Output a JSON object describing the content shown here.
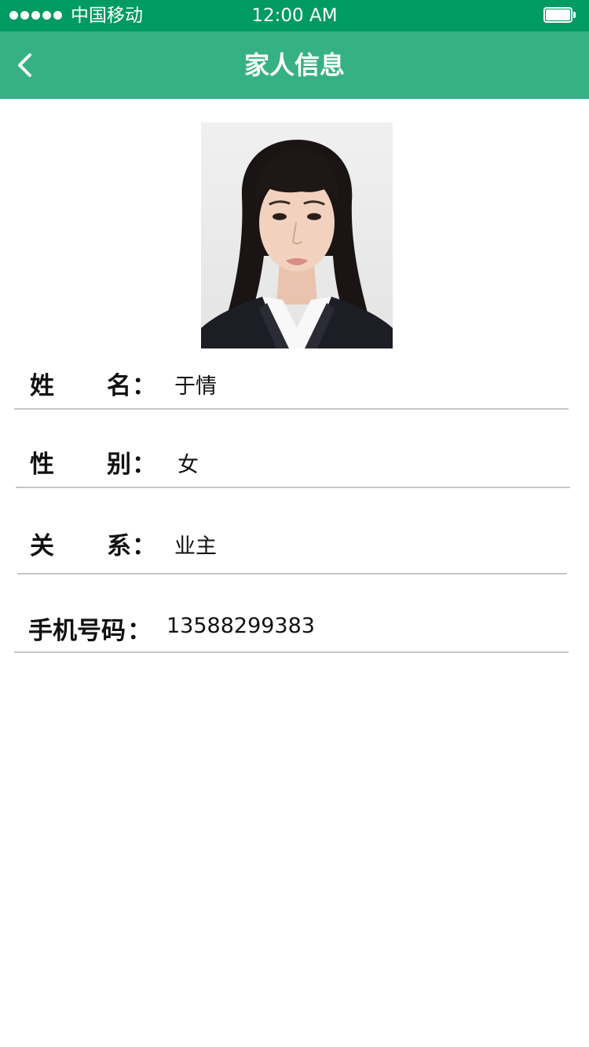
{
  "status_bar": {
    "carrier": "中国移动",
    "time": "12:00 AM",
    "battery_level": 1.0
  },
  "nav": {
    "title": "家人信息",
    "back_icon": "chevron-left-icon"
  },
  "profile": {
    "photo_icon": "person-photo",
    "fields": [
      {
        "label_chars": [
          "姓",
          "名"
        ],
        "colon": "：",
        "value": "于情"
      },
      {
        "label_chars": [
          "性",
          "别"
        ],
        "colon": "：",
        "value": "女"
      },
      {
        "label_chars": [
          "关",
          "系"
        ],
        "colon": "：",
        "value": "业主"
      },
      {
        "label": "手机号码",
        "colon": "：",
        "value": "13588299383"
      }
    ]
  },
  "colors": {
    "status_bar": "#009a63",
    "nav_bar": "#36b183",
    "divider": "#c6c6c6",
    "text": "#111111"
  }
}
